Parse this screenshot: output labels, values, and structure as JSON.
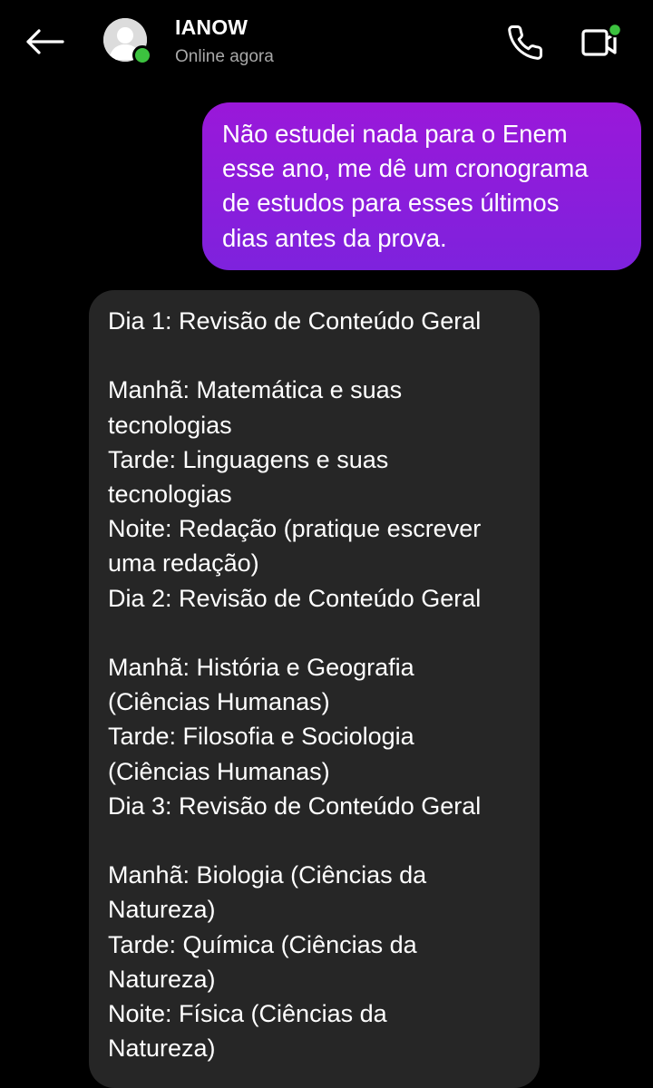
{
  "header": {
    "back_icon": "arrow-left-icon",
    "contact_name": "IANOW",
    "status": "Online agora",
    "call_icon": "phone-icon",
    "video_icon": "video-camera-icon",
    "online_color": "#3cc23f"
  },
  "messages": [
    {
      "type": "sent",
      "text": "Não estudei nada para o Enem\nesse ano, me dê um cronograma\nde estudos  para esses últimos\ndias antes da prova.",
      "bubble_color": "#8a1de0"
    },
    {
      "type": "received",
      "text": "Dia 1: Revisão de Conteúdo Geral\n\nManhã: Matemática e suas\ntecnologias\nTarde: Linguagens e suas\ntecnologias\nNoite: Redação (pratique escrever\numa redação)\nDia 2: Revisão de Conteúdo Geral\n\nManhã: História e Geografia\n(Ciências Humanas)\nTarde: Filosofia e Sociologia\n(Ciências Humanas)\nDia 3: Revisão de Conteúdo Geral\n\nManhã: Biologia (Ciências da\nNatureza)\nTarde: Química (Ciências da\nNatureza)\nNoite: Física (Ciências da\nNatureza)",
      "bubble_color": "#262626"
    }
  ]
}
